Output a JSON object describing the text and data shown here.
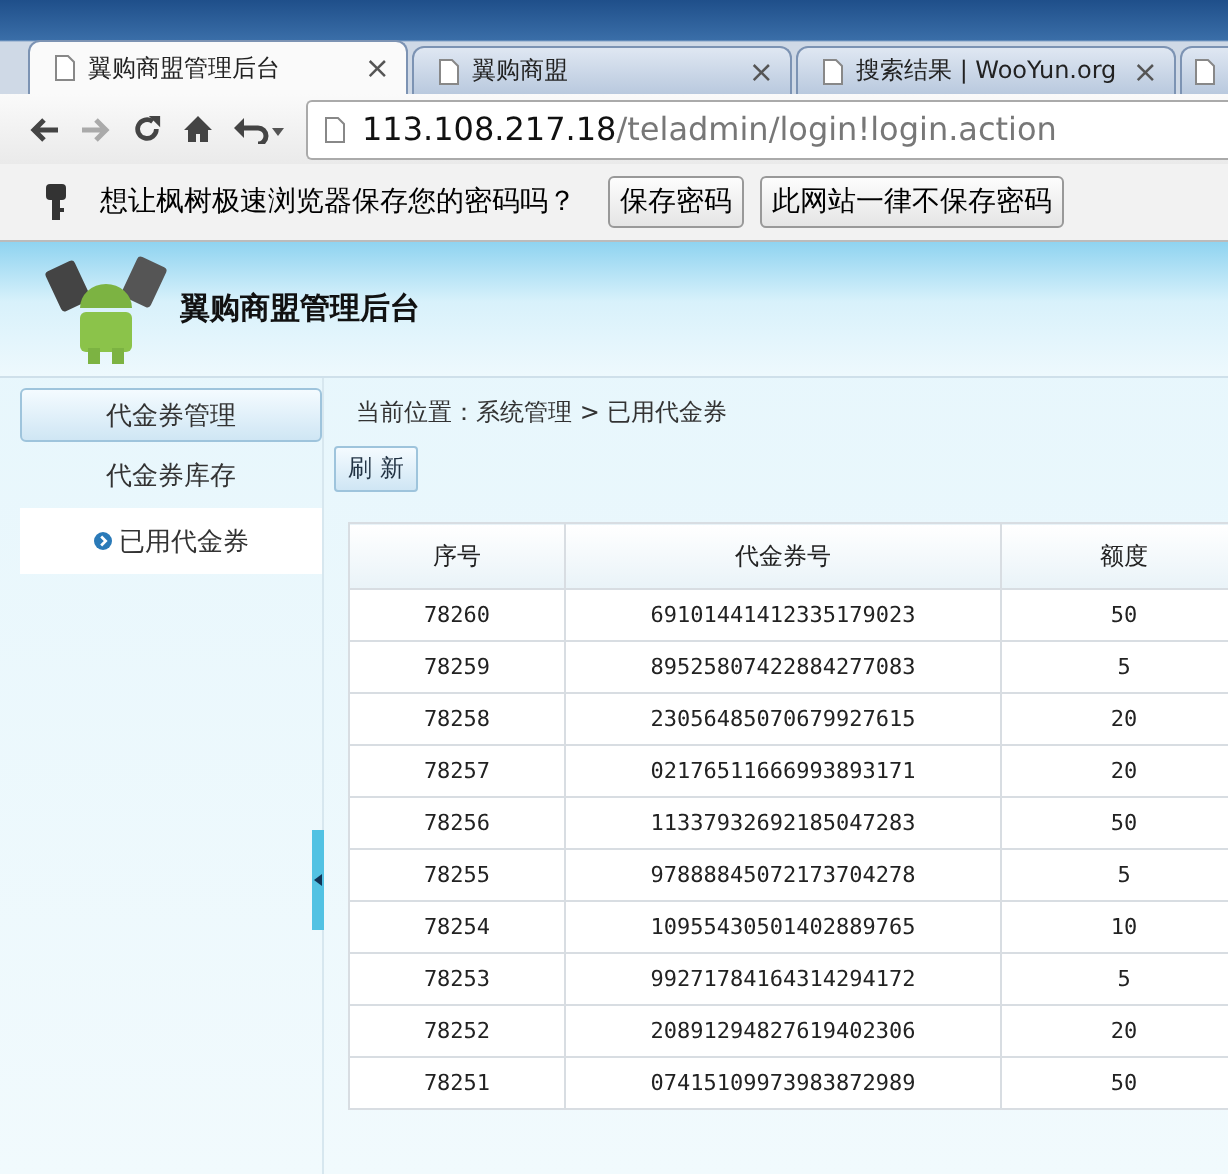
{
  "browser": {
    "tabs": [
      {
        "title": "翼购商盟管理后台",
        "close": "×",
        "selected": true
      },
      {
        "title": "翼购商盟",
        "close": "×",
        "selected": false
      },
      {
        "title": "搜索结果 | WooYun.org",
        "close": "×",
        "selected": false
      },
      {
        "selected": false
      }
    ],
    "address": {
      "host": "113.108.217.18",
      "path": "/teladmin/login!login.action"
    },
    "password_bar": {
      "message": "想让枫树极速浏览器保存您的密码吗？",
      "buttons": [
        "保存密码",
        "此网站一律不保存密码"
      ]
    }
  },
  "header": {
    "title": "翼购商盟管理后台"
  },
  "sidebar": {
    "section": "代金券管理",
    "items": [
      {
        "label": "代金券库存",
        "selected": false
      },
      {
        "label": "已用代金券",
        "selected": true
      }
    ]
  },
  "breadcrumb": "当前位置：系统管理 > 已用代金券",
  "toolbar": {
    "refresh": "刷 新"
  },
  "table": {
    "columns": [
      "序号",
      "代金券号",
      "额度"
    ],
    "rows": [
      [
        "78260",
        "69101441412335179023",
        "50"
      ],
      [
        "78259",
        "89525807422884277083",
        "5"
      ],
      [
        "78258",
        "23056485070679927615",
        "20"
      ],
      [
        "78257",
        "02176511666993893171",
        "20"
      ],
      [
        "78256",
        "11337932692185047283",
        "50"
      ],
      [
        "78255",
        "97888845072173704278",
        "5"
      ],
      [
        "78254",
        "10955430501402889765",
        "10"
      ],
      [
        "78253",
        "99271784164314294172",
        "5"
      ],
      [
        "78252",
        "20891294827619402306",
        "20"
      ],
      [
        "78251",
        "07415109973983872989",
        "50"
      ]
    ]
  }
}
